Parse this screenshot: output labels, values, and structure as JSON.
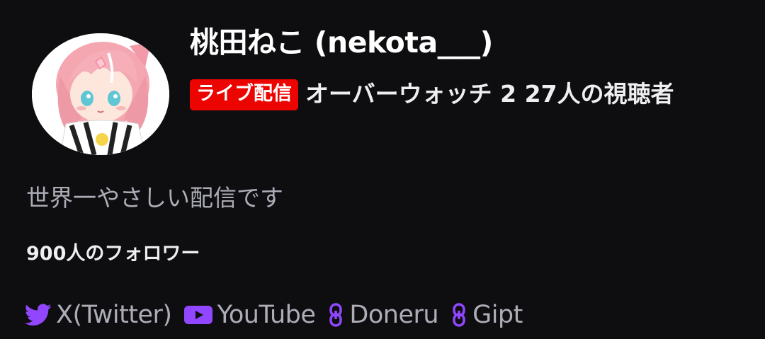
{
  "channel": {
    "name": "桃田ねこ (nekota___)",
    "live_badge": "ライブ配信",
    "meta_text": "オーバーウォッチ 2 27人の視聴者",
    "description": "世界一やさしい配信です",
    "followers": "900人のフォロワー"
  },
  "links": [
    {
      "label": "X(Twitter)",
      "icon": "twitter-bird-icon"
    },
    {
      "label": "YouTube",
      "icon": "youtube-play-icon"
    },
    {
      "label": "Doneru",
      "icon": "link-chain-icon"
    },
    {
      "label": "Gipt",
      "icon": "link-chain-icon"
    }
  ],
  "colors": {
    "background": "#0e0e10",
    "live": "#eb0400",
    "accent": "#9147ff",
    "muted_text": "#adadb8"
  }
}
